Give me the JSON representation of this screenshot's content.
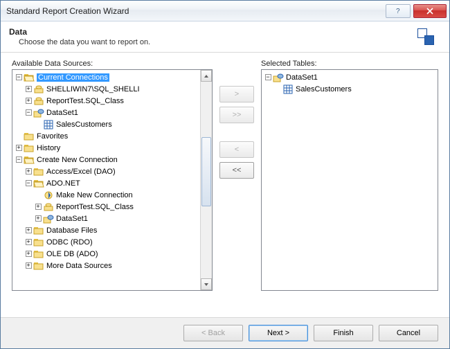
{
  "window": {
    "title": "Standard Report Creation Wizard"
  },
  "header": {
    "title": "Data",
    "subtitle": "Choose the data you want to report on."
  },
  "left": {
    "label": "Available Data Sources:",
    "tree": {
      "cc": "Current Connections",
      "cc1": "SHELLIWIN7\\SQL_SHELLI",
      "cc2": "ReportTest.SQL_Class",
      "cc3": "DataSet1",
      "cc3a": "SalesCustomers",
      "fav": "Favorites",
      "hist": "History",
      "cnc": "Create New Connection",
      "cnc1": "Access/Excel (DAO)",
      "cnc2": "ADO.NET",
      "cnc2a": "Make New Connection",
      "cnc2b": "ReportTest.SQL_Class",
      "cnc2c": "DataSet1",
      "cnc3": "Database Files",
      "cnc4": "ODBC (RDO)",
      "cnc5": "OLE DB (ADO)",
      "cnc6": "More Data Sources"
    }
  },
  "right": {
    "label": "Selected Tables:",
    "ds": "DataSet1",
    "tbl": "SalesCustomers"
  },
  "mid": {
    "add": ">",
    "addall": ">>",
    "rem": "<",
    "remall": "<<"
  },
  "footer": {
    "back": "< Back",
    "next": "Next >",
    "finish": "Finish",
    "cancel": "Cancel"
  }
}
